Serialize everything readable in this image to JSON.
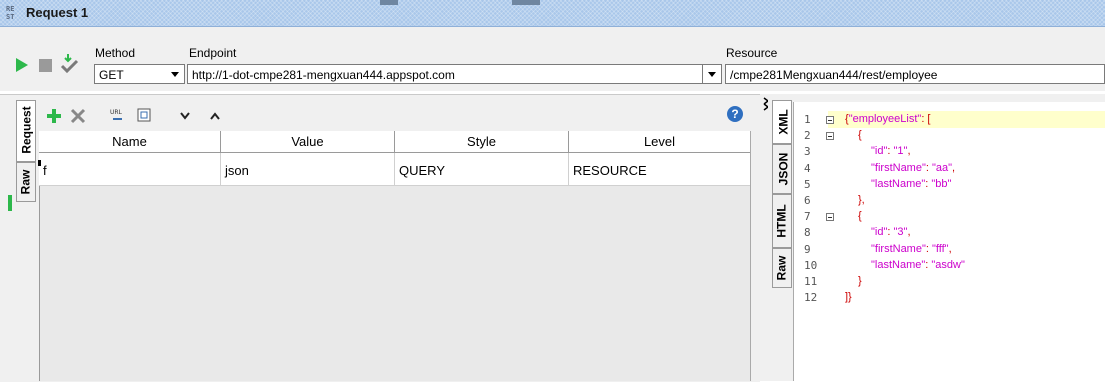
{
  "window": {
    "title": "Request 1",
    "icon_text": "RE ST"
  },
  "toolbar": {
    "method_label": "Method",
    "method_value": "GET",
    "endpoint_label": "Endpoint",
    "endpoint_value": "http://1-dot-cmpe281-mengxuan444.appspot.com",
    "resource_label": "Resource",
    "resource_value": "/cmpe281Mengxuan444/rest/employee"
  },
  "left_tabs": [
    "Request",
    "Raw"
  ],
  "params_toolbar": {
    "add": "add-icon",
    "remove": "remove-icon",
    "help": "?"
  },
  "table": {
    "headers": [
      "Name",
      "Value",
      "Style",
      "Level"
    ],
    "rows": [
      {
        "name": "f",
        "value": "json",
        "style": "QUERY",
        "level": "RESOURCE"
      }
    ]
  },
  "right_tabs": [
    "XML",
    "JSON",
    "HTML",
    "Raw"
  ],
  "response": {
    "line_numbers": [
      "1",
      "2",
      "3",
      "4",
      "5",
      "6",
      "7",
      "8",
      "9",
      "10",
      "11",
      "12"
    ],
    "lines": [
      "{\"employeeList\": [",
      "{",
      "\"id\": \"1\",",
      "\"firstName\": \"aa\",",
      "\"lastName\": \"bb\"",
      "},",
      "{",
      "\"id\": \"3\",",
      "\"firstName\": \"fff\",",
      "\"lastName\": \"asdw\"",
      "}",
      "]}"
    ]
  },
  "colors": {
    "titlebar": "#a9c7ea",
    "run_green": "#2db84b",
    "key_color": "#cc00cc",
    "highlight": "#ffffcc"
  }
}
